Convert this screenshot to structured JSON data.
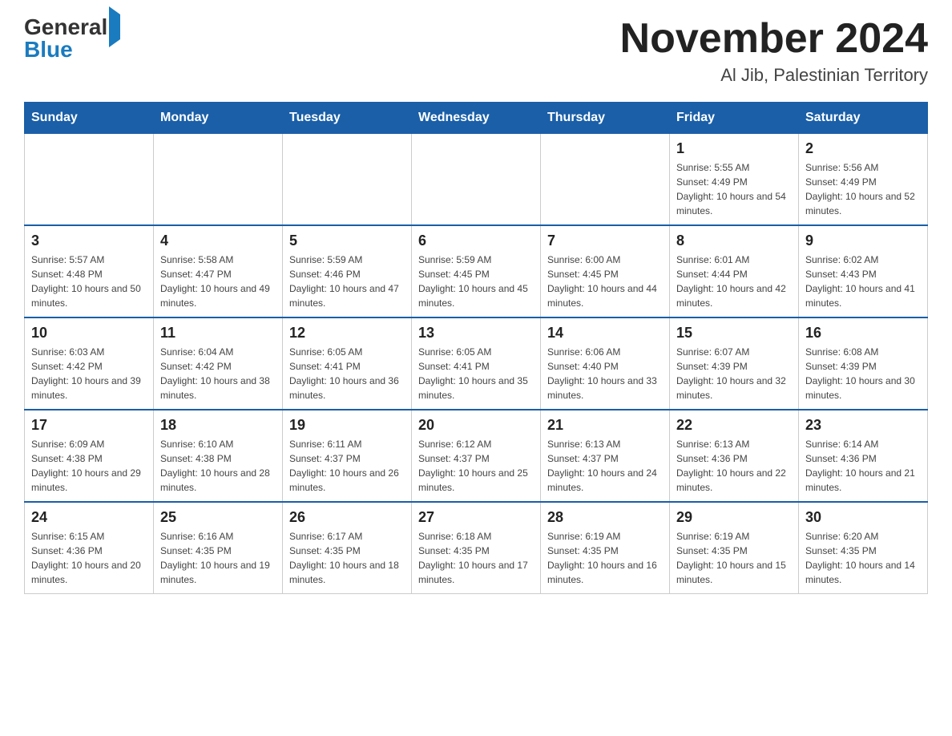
{
  "header": {
    "logo": {
      "general": "General",
      "blue": "Blue"
    },
    "title": "November 2024",
    "location": "Al Jib, Palestinian Territory"
  },
  "weekdays": [
    "Sunday",
    "Monday",
    "Tuesday",
    "Wednesday",
    "Thursday",
    "Friday",
    "Saturday"
  ],
  "weeks": [
    [
      {
        "day": "",
        "info": ""
      },
      {
        "day": "",
        "info": ""
      },
      {
        "day": "",
        "info": ""
      },
      {
        "day": "",
        "info": ""
      },
      {
        "day": "",
        "info": ""
      },
      {
        "day": "1",
        "info": "Sunrise: 5:55 AM\nSunset: 4:49 PM\nDaylight: 10 hours and 54 minutes."
      },
      {
        "day": "2",
        "info": "Sunrise: 5:56 AM\nSunset: 4:49 PM\nDaylight: 10 hours and 52 minutes."
      }
    ],
    [
      {
        "day": "3",
        "info": "Sunrise: 5:57 AM\nSunset: 4:48 PM\nDaylight: 10 hours and 50 minutes."
      },
      {
        "day": "4",
        "info": "Sunrise: 5:58 AM\nSunset: 4:47 PM\nDaylight: 10 hours and 49 minutes."
      },
      {
        "day": "5",
        "info": "Sunrise: 5:59 AM\nSunset: 4:46 PM\nDaylight: 10 hours and 47 minutes."
      },
      {
        "day": "6",
        "info": "Sunrise: 5:59 AM\nSunset: 4:45 PM\nDaylight: 10 hours and 45 minutes."
      },
      {
        "day": "7",
        "info": "Sunrise: 6:00 AM\nSunset: 4:45 PM\nDaylight: 10 hours and 44 minutes."
      },
      {
        "day": "8",
        "info": "Sunrise: 6:01 AM\nSunset: 4:44 PM\nDaylight: 10 hours and 42 minutes."
      },
      {
        "day": "9",
        "info": "Sunrise: 6:02 AM\nSunset: 4:43 PM\nDaylight: 10 hours and 41 minutes."
      }
    ],
    [
      {
        "day": "10",
        "info": "Sunrise: 6:03 AM\nSunset: 4:42 PM\nDaylight: 10 hours and 39 minutes."
      },
      {
        "day": "11",
        "info": "Sunrise: 6:04 AM\nSunset: 4:42 PM\nDaylight: 10 hours and 38 minutes."
      },
      {
        "day": "12",
        "info": "Sunrise: 6:05 AM\nSunset: 4:41 PM\nDaylight: 10 hours and 36 minutes."
      },
      {
        "day": "13",
        "info": "Sunrise: 6:05 AM\nSunset: 4:41 PM\nDaylight: 10 hours and 35 minutes."
      },
      {
        "day": "14",
        "info": "Sunrise: 6:06 AM\nSunset: 4:40 PM\nDaylight: 10 hours and 33 minutes."
      },
      {
        "day": "15",
        "info": "Sunrise: 6:07 AM\nSunset: 4:39 PM\nDaylight: 10 hours and 32 minutes."
      },
      {
        "day": "16",
        "info": "Sunrise: 6:08 AM\nSunset: 4:39 PM\nDaylight: 10 hours and 30 minutes."
      }
    ],
    [
      {
        "day": "17",
        "info": "Sunrise: 6:09 AM\nSunset: 4:38 PM\nDaylight: 10 hours and 29 minutes."
      },
      {
        "day": "18",
        "info": "Sunrise: 6:10 AM\nSunset: 4:38 PM\nDaylight: 10 hours and 28 minutes."
      },
      {
        "day": "19",
        "info": "Sunrise: 6:11 AM\nSunset: 4:37 PM\nDaylight: 10 hours and 26 minutes."
      },
      {
        "day": "20",
        "info": "Sunrise: 6:12 AM\nSunset: 4:37 PM\nDaylight: 10 hours and 25 minutes."
      },
      {
        "day": "21",
        "info": "Sunrise: 6:13 AM\nSunset: 4:37 PM\nDaylight: 10 hours and 24 minutes."
      },
      {
        "day": "22",
        "info": "Sunrise: 6:13 AM\nSunset: 4:36 PM\nDaylight: 10 hours and 22 minutes."
      },
      {
        "day": "23",
        "info": "Sunrise: 6:14 AM\nSunset: 4:36 PM\nDaylight: 10 hours and 21 minutes."
      }
    ],
    [
      {
        "day": "24",
        "info": "Sunrise: 6:15 AM\nSunset: 4:36 PM\nDaylight: 10 hours and 20 minutes."
      },
      {
        "day": "25",
        "info": "Sunrise: 6:16 AM\nSunset: 4:35 PM\nDaylight: 10 hours and 19 minutes."
      },
      {
        "day": "26",
        "info": "Sunrise: 6:17 AM\nSunset: 4:35 PM\nDaylight: 10 hours and 18 minutes."
      },
      {
        "day": "27",
        "info": "Sunrise: 6:18 AM\nSunset: 4:35 PM\nDaylight: 10 hours and 17 minutes."
      },
      {
        "day": "28",
        "info": "Sunrise: 6:19 AM\nSunset: 4:35 PM\nDaylight: 10 hours and 16 minutes."
      },
      {
        "day": "29",
        "info": "Sunrise: 6:19 AM\nSunset: 4:35 PM\nDaylight: 10 hours and 15 minutes."
      },
      {
        "day": "30",
        "info": "Sunrise: 6:20 AM\nSunset: 4:35 PM\nDaylight: 10 hours and 14 minutes."
      }
    ]
  ]
}
